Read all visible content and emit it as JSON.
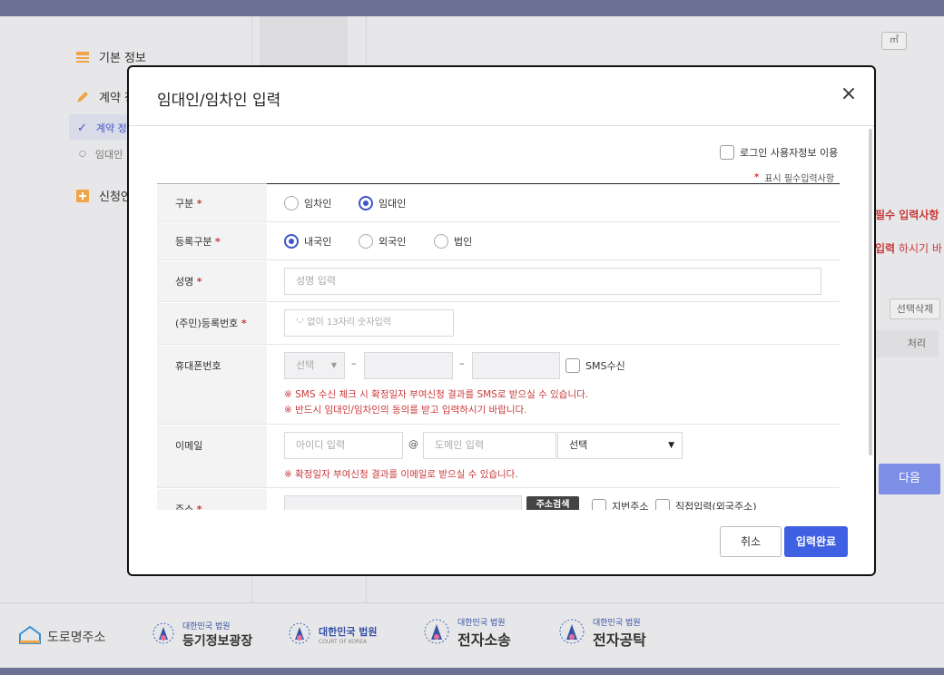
{
  "sidebar": {
    "items": [
      {
        "label": "기본 정보"
      },
      {
        "label": "계약 정"
      },
      {
        "label": "신청인"
      }
    ],
    "sub_items": [
      {
        "label": "계약 정"
      },
      {
        "label": "임대인"
      }
    ]
  },
  "right_panel": {
    "unit_label": "㎡",
    "required_note": "필수 입력사항",
    "input_note_bold": "입력",
    "input_note_rest": " 하시기 바",
    "delete_button": "선택삭제",
    "column_process": "처리",
    "next_button": "다음"
  },
  "modal": {
    "title": "임대인/임차인 입력",
    "use_login_info_label": "로그인 사용자정보 이용",
    "required_marker": "*",
    "required_legend": "표시 필수입력사항",
    "fields": {
      "division": {
        "label": "구분",
        "options": [
          "임차인",
          "임대인"
        ],
        "selected": "임대인"
      },
      "registration_type": {
        "label": "등록구분",
        "options": [
          "내국인",
          "외국인",
          "법인"
        ],
        "selected": "내국인"
      },
      "name": {
        "label": "성명",
        "placeholder": "성명 입력"
      },
      "reg_number": {
        "label": "(주민)등록번호",
        "placeholder": "'-' 없이 13자리 숫자입력"
      },
      "phone": {
        "label": "휴대폰번호",
        "select_value": "선택",
        "dash": "–",
        "sms_label": "SMS수신",
        "notes": [
          "※ SMS 수신 체크 시 확정일자 부여신청 결과를 SMS로 받으실 수 있습니다.",
          "※ 반드시 임대인/임차인의 동의를 받고 입력하시기 바랍니다."
        ]
      },
      "email": {
        "label": "이메일",
        "id_placeholder": "아이디 입력",
        "at": "@",
        "domain_placeholder": "도메인 입력",
        "select_value": "선택",
        "note": "※ 확정일자 부여신청 결과를 이메일로 받으실 수 있습니다."
      },
      "address": {
        "label": "주소",
        "search_button": "주소검색",
        "jibun_label": "지번주소",
        "direct_label": "직접입력(외국주소)"
      }
    },
    "cancel_button": "취소",
    "submit_button": "입력완료"
  },
  "footer": {
    "logos": [
      {
        "name": "도로명주소"
      },
      {
        "top": "대한민국 법원",
        "name": "등기정보광장"
      },
      {
        "top": "대한민국 법원",
        "sub": "COURT OF KOREA"
      },
      {
        "top": "대한민국 법원",
        "name": "전자소송"
      },
      {
        "top": "대한민국 법원",
        "name": "전자공탁"
      }
    ]
  }
}
